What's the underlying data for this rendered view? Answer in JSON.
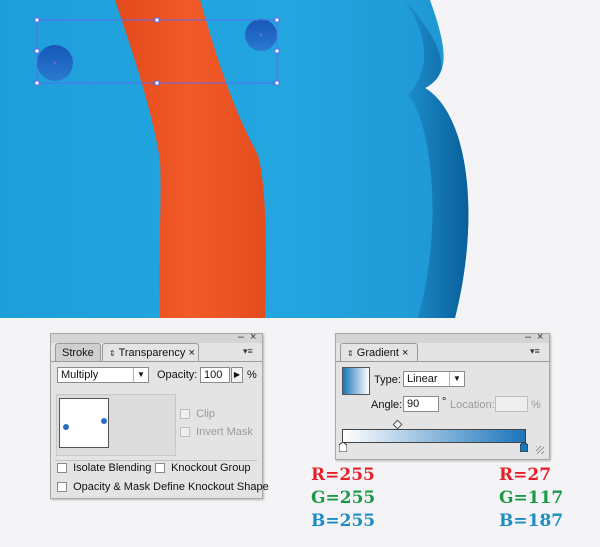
{
  "colors": {
    "canvas_bg": "#f4f4f6",
    "sky_blue": "#23a6e0",
    "dark_blue": "#0d6aa6",
    "orange": "#f05423",
    "selection": "#5a6cf0",
    "red_label": "#e8202a",
    "green_label": "#1a9a48",
    "blue_label": "#1c8cc4"
  },
  "transparency_panel": {
    "tabs": [
      {
        "label": "Stroke",
        "chevron": "⇕"
      },
      {
        "label": "Transparency",
        "chevron": "⇕"
      }
    ],
    "blend_mode": "Multiply",
    "opacity_label": "Opacity:",
    "opacity_value": "100",
    "percent": "%",
    "clip_label": "Clip",
    "invert_mask_label": "Invert Mask",
    "isolate_blending_label": "Isolate Blending",
    "knockout_group_label": "Knockout Group",
    "opacity_mask_label": "Opacity & Mask Define Knockout Shape"
  },
  "gradient_panel": {
    "tab_label": "Gradient",
    "type_label": "Type:",
    "type_value": "Linear",
    "angle_label": "Angle:",
    "angle_value": "90",
    "degree_symbol": "°",
    "location_label": "Location:",
    "location_value": "",
    "percent": "%",
    "stops": [
      {
        "r": 255,
        "g": 255,
        "b": 255
      },
      {
        "r": 27,
        "g": 117,
        "b": 187
      }
    ]
  },
  "rgb_labels": {
    "left": {
      "r": "R=255",
      "g": "G=255",
      "b": "B=255"
    },
    "right": {
      "r": "R=27",
      "g": "G=117",
      "b": "B=187"
    }
  },
  "window_controls": {
    "minimize": "–",
    "close": "×",
    "menu": "▾≡"
  }
}
